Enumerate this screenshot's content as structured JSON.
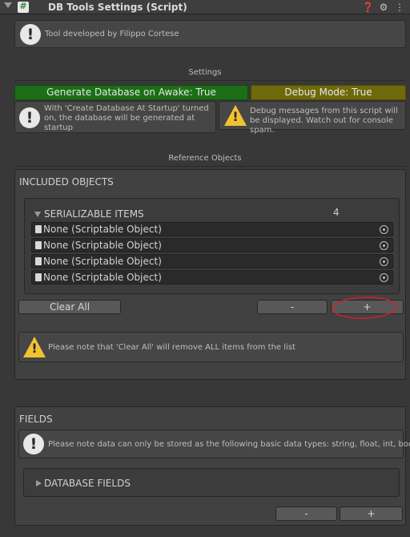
{
  "header": {
    "title": "DB Tools Settings (Script)",
    "icons": [
      "fold-arrow",
      "script-icon",
      "help-icon",
      "preset-icon",
      "more-icon"
    ]
  },
  "intro_help": "Tool developed by Filippo Cortese",
  "settings": {
    "label": "Settings",
    "generate_db_toggle": "Generate Database on Awake: True",
    "debug_mode_toggle": "Debug Mode: True",
    "generate_help": "With 'Create Database At Startup' turned on, the database will be generated at startup",
    "debug_help": "Debug messages from this script will be displayed. Watch out for console spam."
  },
  "reference": {
    "label": "Reference Objects",
    "included_title": "INCLUDED OBJECTS",
    "list_header": "SERIALIZABLE ITEMS",
    "list_count": "4",
    "items": [
      "None (Scriptable Object)",
      "None (Scriptable Object)",
      "None (Scriptable Object)",
      "None (Scriptable Object)"
    ],
    "clear_all": "Clear All",
    "minus": "-",
    "plus": "+",
    "clear_help": "Please note that 'Clear All' will remove ALL items from the list"
  },
  "fields": {
    "title": "FIELDS",
    "help": "Please note data can only be stored as the following basic data types: string, float, int, bool",
    "foldout": "DATABASE FIELDS",
    "minus": "-",
    "plus": "+"
  },
  "colors": {
    "background": "#383838",
    "green_toggle": "#1c6e17",
    "olive_toggle": "#6e6a0b",
    "annotation_red": "#d0202a",
    "warning_yellow": "#f1c232"
  }
}
